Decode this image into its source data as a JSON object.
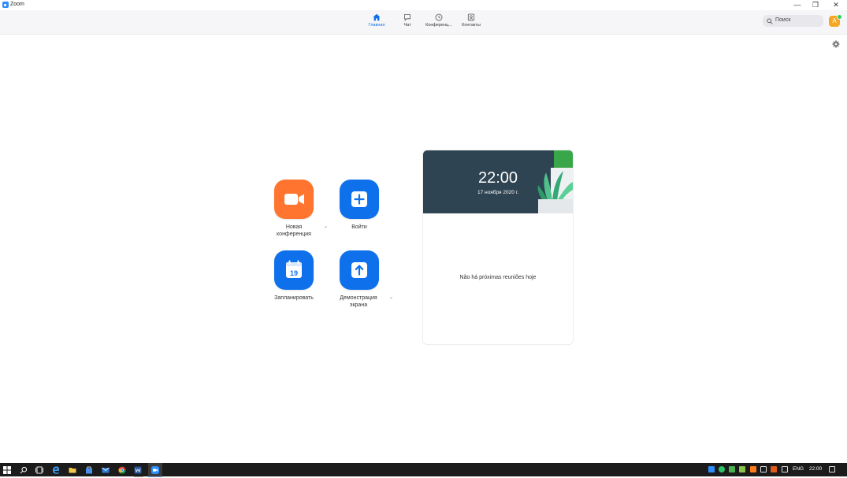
{
  "window": {
    "title": "Zoom",
    "controls": {
      "minimize": "—",
      "restore": "❐",
      "close": "✕"
    }
  },
  "nav": {
    "tabs": [
      {
        "label": "Главная",
        "icon": "home-icon",
        "active": true
      },
      {
        "label": "Чат",
        "icon": "chat-icon",
        "active": false
      },
      {
        "label": "Конференц...",
        "icon": "clock-icon",
        "active": false
      },
      {
        "label": "Контакты",
        "icon": "contacts-icon",
        "active": false
      }
    ],
    "search_placeholder": "Поиск",
    "avatar_initial": "A"
  },
  "actions": {
    "new_meeting": "Новая конференция",
    "join": "Войти",
    "schedule": "Запланировать",
    "schedule_day": "19",
    "share_screen": "Демонстрация экрана"
  },
  "meeting_card": {
    "time": "22:00",
    "date": "17 ноября 2020 г.",
    "empty_text": "Não há próximas reuniões hoje"
  },
  "taskbar": {
    "language": "ENG",
    "clock": "22:00"
  },
  "colors": {
    "accent": "#0e71eb",
    "orange": "#ff742e",
    "blue": "#0e71eb",
    "card_header": "#2f4452"
  }
}
